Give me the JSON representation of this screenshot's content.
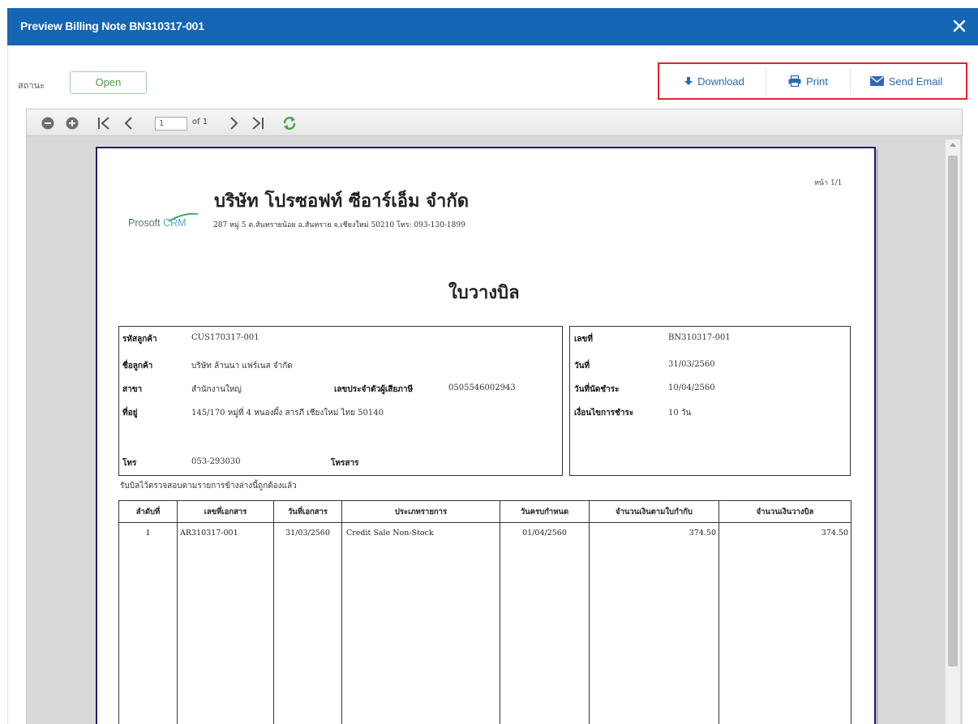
{
  "window": {
    "title": "Preview Billing Note BN310317-001",
    "close_icon": "close-icon"
  },
  "status": {
    "label": "สถานะ",
    "value": "Open"
  },
  "actions": [
    {
      "label": "Download",
      "icon": "download-icon"
    },
    {
      "label": "Print",
      "icon": "print-icon"
    },
    {
      "label": "Send Email",
      "icon": "email-icon"
    }
  ],
  "viewer": {
    "page_input": "1",
    "page_of": "of 1"
  },
  "report": {
    "company_name": "บริษัท โปรซอฟท์ ซีอาร์เอ็ม จำกัด",
    "logo": {
      "text": "Prosoft",
      "accent": "CRM"
    },
    "address": "287 หมู่ 5 ต.สันทรายน้อย อ.สันทราย จ.เชียงใหม่ 50210 โทร: 093-130-1899",
    "page_number": "หน้า 1/1",
    "title": "ใบวางบิล",
    "customer": {
      "code_label": "รหัสลูกค้า",
      "code": "CUS170317-001",
      "name_label": "ชื่อลูกค้า",
      "name": "บริษัท ล้านนา แฟร์เนส จำกัด",
      "branch_label": "สาขา",
      "branch": "สำนักงานใหญ่",
      "taxid_label": "เลขประจำตัวผู้เสียภาษี",
      "taxid": "0505546002943",
      "address_label": "ที่อยู่",
      "address": "145/170 หมู่ที่ 4 หนองผึ้ง สารภี เชียงใหม่ ไทย 50140",
      "phone_label": "โทร",
      "phone": "053-293030",
      "fax_label": "โทรสาร",
      "fax": ""
    },
    "doc": {
      "no_label": "เลขที่",
      "no": "BN310317-001",
      "date_label": "วันที่",
      "date": "31/03/2560",
      "due_label": "วันที่นัดชำระ",
      "due": "10/04/2560",
      "terms_label": "เงื่อนไขการชำระ",
      "terms": "10 วัน"
    },
    "received_note": "รับบิลไว้ตรวจสอบตามรายการข้างล่างนี้ถูกต้องแล้ว",
    "table": {
      "headers": [
        "ลำดับที่",
        "เลขที่เอกสาร",
        "วันที่เอกสาร",
        "ประเภทรายการ",
        "วันครบกำหนด",
        "จำนวนเงินตามใบกำกับ",
        "จำนวนเงินวางบิล"
      ],
      "rows": [
        [
          "1",
          "AR310317-001",
          "31/03/2560",
          "Credit Sale Non-Stock",
          "01/04/2560",
          "374.50",
          "374.50"
        ]
      ]
    }
  }
}
